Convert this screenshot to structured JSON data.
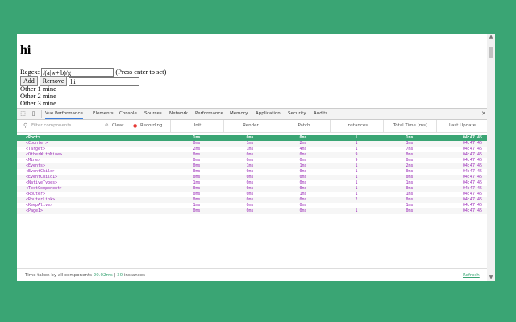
{
  "page": {
    "heading": "hi",
    "regex_label": "Regex:",
    "regex_value": "/(a|w+|b)/g",
    "regex_hint": "(Press enter to set)",
    "add_label": "Add",
    "remove_label": "Remove",
    "add_value": "hi",
    "items": [
      "Other 1 mine",
      "Other 2 mine",
      "Other 3 mine"
    ]
  },
  "devtools": {
    "tabs": [
      "Vue Performance",
      "Elements",
      "Console",
      "Sources",
      "Network",
      "Performance",
      "Memory",
      "Application",
      "Security",
      "Audits"
    ],
    "active_tab": "Vue Performance",
    "filter_placeholder": "Filter components",
    "clear_label": "Clear",
    "recording_label": "Recording",
    "columns": [
      "Init",
      "Render",
      "Patch",
      "Instances",
      "Total Time (ms)",
      "Last Update"
    ],
    "rows": [
      {
        "name": "<Root>",
        "init": "1ms",
        "render": "0ms",
        "patch": "0ms",
        "instances": "1",
        "total": "1ms",
        "last": "04:47:45",
        "selected": true
      },
      {
        "name": "<Counter>",
        "init": "0ms",
        "render": "1ms",
        "patch": "2ms",
        "instances": "1",
        "total": "3ms",
        "last": "04:47:45"
      },
      {
        "name": "<Target>",
        "init": "2ms",
        "render": "1ms",
        "patch": "4ms",
        "instances": "1",
        "total": "7ms",
        "last": "04:47:45"
      },
      {
        "name": "<OtherWithMine>",
        "init": "0ms",
        "render": "0ms",
        "patch": "0ms",
        "instances": "9",
        "total": "0ms",
        "last": "04:47:45"
      },
      {
        "name": "<Mine>",
        "init": "0ms",
        "render": "0ms",
        "patch": "0ms",
        "instances": "9",
        "total": "0ms",
        "last": "04:47:45"
      },
      {
        "name": "<Events>",
        "init": "0ms",
        "render": "1ms",
        "patch": "1ms",
        "instances": "1",
        "total": "2ms",
        "last": "04:47:45"
      },
      {
        "name": "<EventChild>",
        "init": "0ms",
        "render": "0ms",
        "patch": "0ms",
        "instances": "1",
        "total": "0ms",
        "last": "04:47:45"
      },
      {
        "name": "<EventChild1>",
        "init": "0ms",
        "render": "0ms",
        "patch": "0ms",
        "instances": "1",
        "total": "0ms",
        "last": "04:47:45"
      },
      {
        "name": "<NativeTypes>",
        "init": "1ms",
        "render": "0ms",
        "patch": "0ms",
        "instances": "1",
        "total": "1ms",
        "last": "04:47:45"
      },
      {
        "name": "<TestComponent>",
        "init": "0ms",
        "render": "0ms",
        "patch": "0ms",
        "instances": "1",
        "total": "0ms",
        "last": "04:47:45"
      },
      {
        "name": "<Router>",
        "init": "0ms",
        "render": "0ms",
        "patch": "1ms",
        "instances": "1",
        "total": "1ms",
        "last": "04:47:45"
      },
      {
        "name": "<RouterLink>",
        "init": "0ms",
        "render": "0ms",
        "patch": "0ms",
        "instances": "2",
        "total": "0ms",
        "last": "04:47:45"
      },
      {
        "name": "<KeepAlive>",
        "init": "1ms",
        "render": "0ms",
        "patch": "0ms",
        "instances": "",
        "total": "1ms",
        "last": "04:47:45"
      },
      {
        "name": "<Page1>",
        "init": "0ms",
        "render": "0ms",
        "patch": "0ms",
        "instances": "1",
        "total": "0ms",
        "last": "04:47:45"
      }
    ],
    "footer_prefix": "Time taken by all components",
    "footer_time": "20.02ms",
    "footer_sep": "|",
    "footer_instances_count": "30",
    "footer_instances_label": "instances",
    "refresh_label": "Refresh"
  },
  "colors": {
    "accent": "#3aa574",
    "component_text": "#9b2ab8",
    "tab_underline": "#3b7ddd",
    "recording": "#e53935"
  }
}
